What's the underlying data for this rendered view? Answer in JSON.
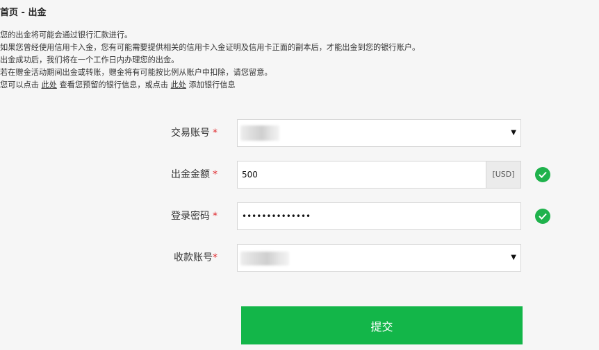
{
  "breadcrumb": "首页 - 出金",
  "notice": {
    "line1": "您的出金将可能会通过银行汇款进行。",
    "line2": "如果您曾经使用信用卡入金，您有可能需要提供相关的信用卡入金证明及信用卡正面的副本后，才能出金到您的银行账户。",
    "line3": "出金成功后，我们将在一个工作日内办理您的出金。",
    "line4": "若在赠金活动期间出金或转账，赠金将有可能按比例从账户中扣除，请您留意。",
    "line5_a": "您可以点击 ",
    "line5_link1": "此处",
    "line5_b": " 查看您预留的银行信息，或点击 ",
    "line5_link2": "此处",
    "line5_c": " 添加银行信息"
  },
  "form": {
    "account_label": "交易账号",
    "amount_label": "出金金额",
    "amount_value": "500",
    "amount_currency": "[USD]",
    "password_label": "登录密码",
    "password_value": "••••••••••••••",
    "receive_label": "收款账号",
    "required_mark": "*",
    "submit_label": "提交"
  },
  "colors": {
    "accent": "#13b649",
    "required": "#e0272b",
    "valid": "#1fb24c"
  },
  "icons": {
    "dropdown": "caret-down-icon",
    "valid": "check-circle-icon"
  }
}
